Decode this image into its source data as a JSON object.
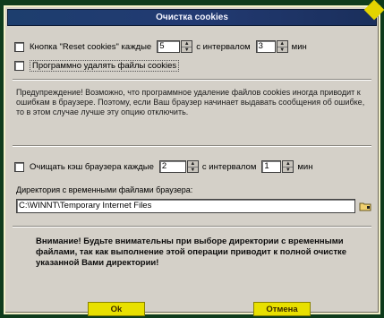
{
  "window": {
    "title": "Очистка cookies"
  },
  "options": {
    "reset_cookies": {
      "label": "Кнопка \"Reset cookies\" каждые",
      "every_value": "5",
      "interval_label": "с интервалом",
      "interval_value": "3",
      "unit": "мин"
    },
    "delete_cookies_programmatically": {
      "label": "Программно удалять файлы cookies"
    }
  },
  "notice_text": "Предупреждение! Возможно, что программное удаление файлов cookies иногда приводит к ошибкам в браузере. Поэтому, если Ваш браузер начинает выдавать сообщения об ошибке, то в этом случае лучше эту опцию отключить.",
  "cache": {
    "label": "Очищать кэш браузера каждые",
    "every_value": "2",
    "interval_label": "с интервалом",
    "interval_value": "1",
    "unit": "мин",
    "dir_label": "Директория с временными файлами браузера:",
    "dir_value": "C:\\WINNT\\Temporary Internet Files"
  },
  "warning_text": "Внимание! Будьте внимательны при выборе директории с временными файлами, так как выполнение этой операции приводит к полной очистке указанной Вами директории!",
  "buttons": {
    "ok": "Ok",
    "cancel": "Отмена"
  },
  "colors": {
    "background": "#0e3b1c",
    "dialog": "#d4d0c8",
    "title_bar": "#1d3e6e",
    "button": "#e8e000"
  },
  "icons": {
    "spinner": "spinner-arrows-icon",
    "folder": "folder-browse-icon",
    "corner": "corner-marker-icon"
  }
}
